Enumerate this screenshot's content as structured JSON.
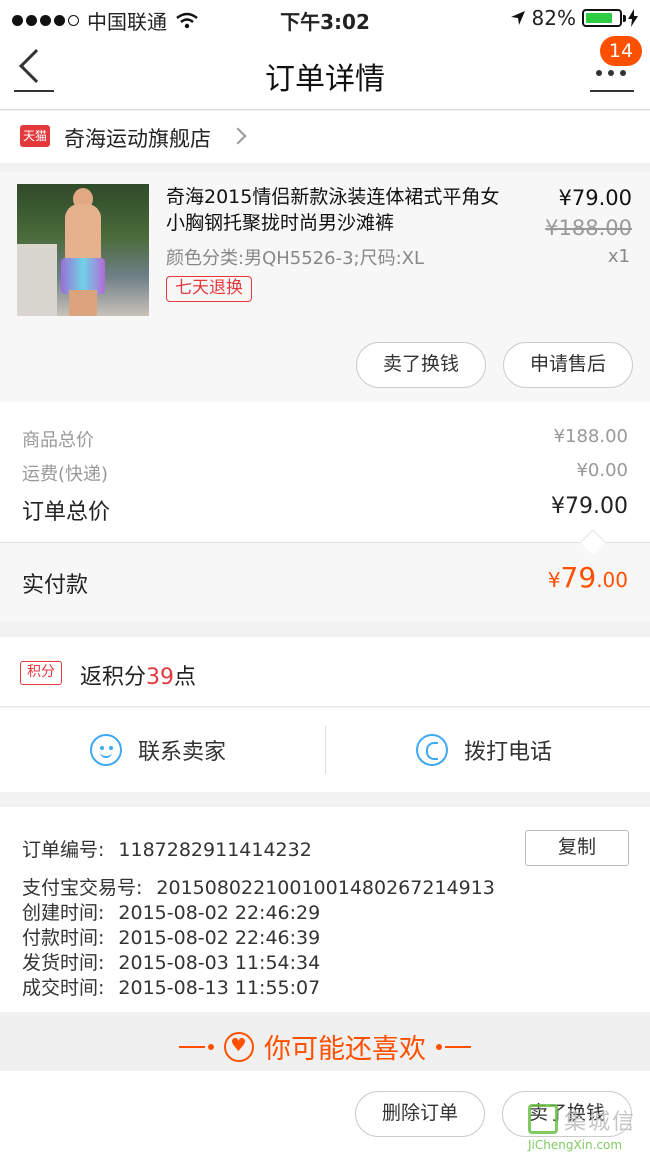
{
  "status": {
    "carrier": "中国联通",
    "time": "下午3:02",
    "battery": "82%",
    "battery_level": 0.82
  },
  "nav": {
    "title": "订单详情",
    "badge_count": "14"
  },
  "shop": {
    "logo_text": "天猫",
    "name": "奇海运动旗舰店"
  },
  "item": {
    "title": "奇海2015情侣新款泳装连体裙式平角女小胸钢托聚拢时尚男沙滩裤",
    "sku": "颜色分类:男QH5526-3;尺码:XL",
    "tag": "七天退换",
    "price_now": "¥79.00",
    "price_old": "¥188.00",
    "qty": "x1",
    "actions": [
      "卖了换钱",
      "申请售后"
    ]
  },
  "summary": {
    "goods_total_label": "商品总价",
    "goods_total_value": "¥188.00",
    "shipping_label": "运费(快递)",
    "shipping_value": "¥0.00",
    "order_total_label": "订单总价",
    "order_total_value": "¥79.00",
    "paid_label": "实付款",
    "paid_currency": "¥",
    "paid_int": "79",
    "paid_dec": ".00"
  },
  "points": {
    "tag": "积分",
    "prefix": "返积分",
    "value": "39",
    "suffix": "点"
  },
  "contact": {
    "seller": "联系卖家",
    "phone": "拨打电话"
  },
  "order_info": {
    "copy_label": "复制",
    "lines": [
      {
        "k": "订单编号:",
        "v": "1187282911414232"
      },
      {
        "k": "支付宝交易号:",
        "v": "2015080221001001480267214913"
      },
      {
        "k": "创建时间:",
        "v": "2015-08-02 22:46:29"
      },
      {
        "k": "付款时间:",
        "v": "2015-08-02 22:46:39"
      },
      {
        "k": "发货时间:",
        "v": "2015-08-03 11:54:34"
      },
      {
        "k": "成交时间:",
        "v": "2015-08-13 11:55:07"
      }
    ]
  },
  "recommend": {
    "title": "你可能还喜欢"
  },
  "bottom": {
    "actions": [
      "删除订单",
      "卖了换钱"
    ]
  },
  "watermark": {
    "cn": "集城信",
    "en": "JiChengXin.com"
  },
  "colors": {
    "accent": "#ff5000",
    "tmall_red": "#e4393c",
    "contact_blue": "#3fa9f5"
  }
}
